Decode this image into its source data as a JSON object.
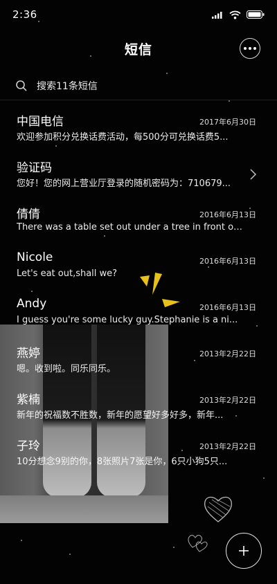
{
  "status_bar": {
    "time": "2:36"
  },
  "header": {
    "title": "短信"
  },
  "search": {
    "placeholder": "搜索11条短信"
  },
  "messages": [
    {
      "name": "中国电信",
      "date": "2017年6月30日",
      "snippet": "欢迎参加积分兑换话费活动，每500分可兑换话费5...",
      "has_chevron": false
    },
    {
      "name": "验证码",
      "date": "",
      "snippet": "您好！您的网上营业厅登录的随机密码为：710679...",
      "has_chevron": true
    },
    {
      "name": "倩倩",
      "date": "2016年6月13日",
      "snippet": "There was a table set out under a tree in front of ...",
      "has_chevron": false
    },
    {
      "name": "Nicole",
      "date": "2016年6月13日",
      "snippet": "Let's eat out,shall we?",
      "has_chevron": false
    },
    {
      "name": "Andy",
      "date": "2016年6月13日",
      "snippet": "I guess you're some lucky guy.Stephanie is a ni...",
      "has_chevron": false
    },
    {
      "name": "燕婷",
      "date": "2013年2月22日",
      "snippet": "嗯。收到啦。同乐同乐。",
      "has_chevron": false
    },
    {
      "name": "紫楠",
      "date": "2013年2月22日",
      "snippet": "新年的祝福数不胜数，新年的愿望好多好多，新年...",
      "has_chevron": false
    },
    {
      "name": "子玲",
      "date": "2013年2月22日",
      "snippet": "10分想念9别的你，8张照片7张是你，6只小狗5只...",
      "has_chevron": false
    }
  ],
  "icons": {
    "more": "more-icon",
    "search": "search-icon",
    "chevron": "chevron-right-icon",
    "compose": "plus-icon"
  },
  "colors": {
    "background": "#030303",
    "text": "#ffffff",
    "accent_wallpaper": "#e8c21a"
  }
}
